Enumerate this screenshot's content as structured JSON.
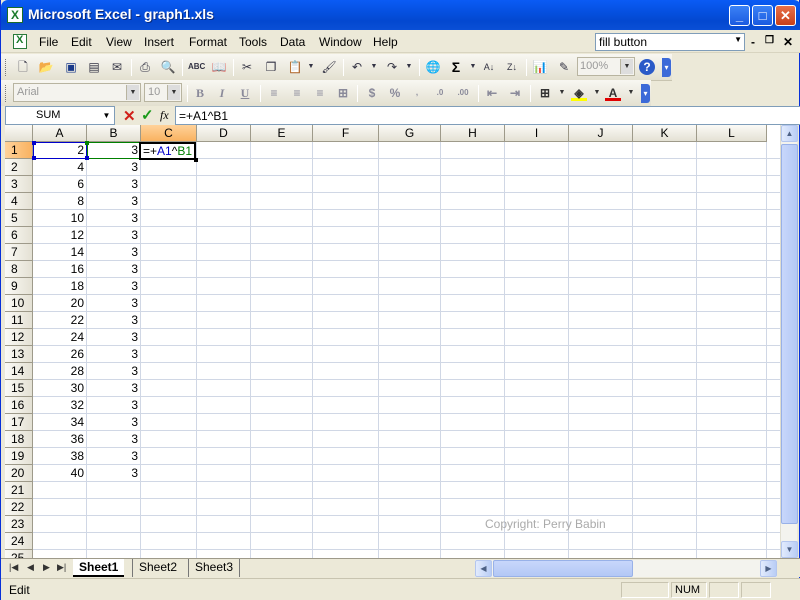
{
  "window": {
    "title": "Microsoft Excel - graph1.xls",
    "min": "_",
    "max": "□",
    "close": "✕"
  },
  "menu": {
    "items": [
      "File",
      "Edit",
      "View",
      "Insert",
      "Format",
      "Tools",
      "Data",
      "Window",
      "Help"
    ],
    "help_query": "fill button",
    "doc_min": "-",
    "doc_restore": "❐",
    "doc_close": "✕"
  },
  "standard_toolbar": {
    "zoom": "100%",
    "sigma": "Σ"
  },
  "formatting_toolbar": {
    "font": "Arial",
    "size": "10",
    "bold": "B",
    "italic": "I",
    "underline": "U",
    "currency": "$",
    "percent": "%"
  },
  "formula_bar": {
    "name_box": "SUM",
    "formula": "=+A1^B1",
    "fx": "fx",
    "cancel": "✕",
    "enter": "✓"
  },
  "columns": [
    "A",
    "B",
    "C",
    "D",
    "E",
    "F",
    "G",
    "H",
    "I",
    "J",
    "K",
    "L"
  ],
  "rows": [
    "1",
    "2",
    "3",
    "4",
    "5",
    "6",
    "7",
    "8",
    "9",
    "10",
    "11",
    "12",
    "13",
    "14",
    "15",
    "16",
    "17",
    "18",
    "19",
    "20",
    "21",
    "22",
    "23",
    "24",
    "25"
  ],
  "cells": {
    "A": [
      "2",
      "4",
      "6",
      "8",
      "10",
      "12",
      "14",
      "16",
      "18",
      "20",
      "22",
      "24",
      "26",
      "28",
      "30",
      "32",
      "34",
      "36",
      "38",
      "40"
    ],
    "B": [
      "3",
      "3",
      "3",
      "3",
      "3",
      "3",
      "3",
      "3",
      "3",
      "3",
      "3",
      "3",
      "3",
      "3",
      "3",
      "3",
      "3",
      "3",
      "3",
      "3"
    ]
  },
  "editing_cell": {
    "prefix": "=+",
    "ref_a": "A1",
    "op": "^",
    "ref_b": "B1"
  },
  "watermark": "Copyright: Perry Babin",
  "sheets": [
    "Sheet1",
    "Sheet2",
    "Sheet3"
  ],
  "status": {
    "mode": "Edit",
    "num": "NUM"
  },
  "colors": {
    "title_blue": "#0550e0",
    "ref_a": "#0000cc",
    "ref_b": "#008000",
    "selected_header": "#f9b260"
  }
}
